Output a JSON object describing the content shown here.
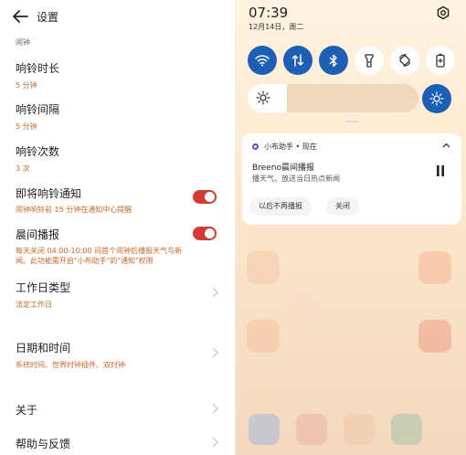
{
  "settings": {
    "title": "设置",
    "section": "闹钟",
    "items": [
      {
        "title": "响铃时长",
        "value": "5 分钟"
      },
      {
        "title": "响铃间隔",
        "value": "5 分钟"
      },
      {
        "title": "响铃次数",
        "value": "3 次"
      },
      {
        "title": "即将响铃通知",
        "desc": "闹钟响铃前 15 分钟在通知中心提醒",
        "toggle": true
      },
      {
        "title": "晨间播报",
        "desc": "每天关闭 04:00-10:00 间首个闹钟后播报天气与新闻。此功能需开启\"小布助手\"的\"通知\"权限",
        "toggle": true
      },
      {
        "title": "工作日类型",
        "value": "法定工作日"
      },
      {
        "title": "日期和时间",
        "desc": "系统时间、世界时钟插件、双时钟"
      },
      {
        "title": "关于"
      },
      {
        "title": "帮助与反馈"
      }
    ]
  },
  "shade": {
    "time": "07:39",
    "date": "12月14日，周二",
    "quick_settings": [
      {
        "icon": "wifi-icon",
        "on": true
      },
      {
        "icon": "mobile-data-icon",
        "on": true
      },
      {
        "icon": "bluetooth-icon",
        "on": true
      },
      {
        "icon": "flashlight-icon",
        "on": false
      },
      {
        "icon": "auto-rotate-icon",
        "on": false
      },
      {
        "icon": "battery-saver-icon",
        "on": false
      }
    ],
    "brightness_level": 0.23,
    "notification": {
      "app": "小布助手 • 现在",
      "title": "Breeno晨间播报",
      "body": "播天气、放送当日热点新闻",
      "buttons": [
        "以后不再播报",
        "关闭"
      ]
    }
  },
  "colors": {
    "accent": "#1e5fb6",
    "toggle": "#d23a34",
    "secondary_text": "#c36a2d"
  }
}
